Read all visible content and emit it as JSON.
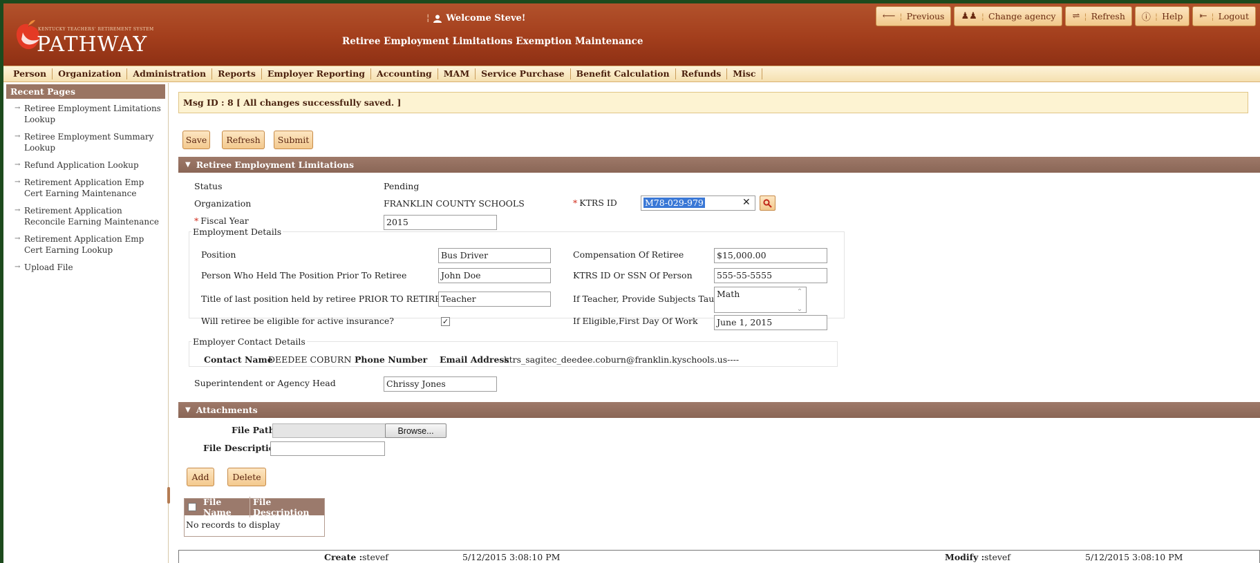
{
  "header": {
    "logo_small": "KENTUCKY TEACHERS' RETIREMENT SYSTEM",
    "logo_big": "PATHWAY",
    "welcome": "Welcome  Steve!",
    "page_title": "Retiree Employment Limitations Exemption Maintenance",
    "buttons": {
      "previous": "Previous",
      "change_agency": "Change agency",
      "refresh": "Refresh",
      "help": "Help",
      "logout": "Logout"
    }
  },
  "menu": [
    "Person",
    "Organization",
    "Administration",
    "Reports",
    "Employer Reporting",
    "Accounting",
    "MAM",
    "Service Purchase",
    "Benefit Calculation",
    "Refunds",
    "Misc"
  ],
  "sidebar": {
    "title": "Recent Pages",
    "items": [
      "Retiree Employment Limitations Lookup",
      "Retiree Employment Summary Lookup",
      "Refund Application Lookup",
      "Retirement Application Emp Cert Earning Maintenance",
      "Retirement Application Reconcile Earning Maintenance",
      "Retirement Application Emp Cert Earning Lookup",
      "Upload File"
    ]
  },
  "message": "Msg ID : 8 [ All changes successfully saved. ]",
  "actions": {
    "save": "Save",
    "refresh": "Refresh",
    "submit": "Submit"
  },
  "limitations": {
    "section_title": "Retiree Employment Limitations",
    "status_label": "Status",
    "status_value": "Pending",
    "organization_label": "Organization",
    "organization_value": "FRANKLIN COUNTY SCHOOLS",
    "ktrs_id_label": "KTRS ID",
    "ktrs_id_value": "M78-029-979",
    "fiscal_year_label": "Fiscal Year",
    "fiscal_year_value": "2015",
    "employment_details": {
      "legend": "Employment Details",
      "position_label": "Position",
      "position_value": "Bus Driver",
      "prior_holder_label": "Person Who Held The Position Prior To Retiree",
      "prior_holder_value": "John Doe",
      "last_title_label": "Title of last position held by retiree PRIOR TO RETIREMENT",
      "last_title_value": "Teacher",
      "insurance_label": "Will retiree be eligible for active insurance?",
      "insurance_checked": "✓",
      "compensation_label": "Compensation Of Retiree",
      "compensation_value": "$15,000.00",
      "ssn_label": "KTRS ID Or SSN Of Person",
      "ssn_value": "555-55-5555",
      "subjects_label": "If Teacher, Provide Subjects Taught",
      "subjects_value": "Math",
      "first_day_label": "If Eligible,First Day Of Work",
      "first_day_value": "June 1, 2015"
    },
    "employer_contact": {
      "legend": "Employer Contact Details",
      "contact_name_label": "Contact Name",
      "contact_name_value": "DEEDEE COBURN",
      "phone_label": "Phone Number",
      "phone_value": "",
      "email_label": "Email Address",
      "email_value": "ktrs_sagitec_deedee.coburn@franklin.kyschools.us----"
    },
    "superintendent_label": "Superintendent or Agency Head",
    "superintendent_value": "Chrissy Jones"
  },
  "attachments": {
    "section_title": "Attachments",
    "file_path_label": "File Path",
    "browse_label": "Browse...",
    "file_description_label": "File Description",
    "add_label": "Add",
    "delete_label": "Delete",
    "columns": [
      "File Name",
      "File Description"
    ],
    "empty_text": "No records to display"
  },
  "footer": {
    "create_label": "Create :",
    "create_user": "stevef",
    "create_date": "5/12/2015 3:08:10 PM",
    "modify_label": "Modify :",
    "modify_user": "stevef",
    "modify_date": "5/12/2015 3:08:10 PM"
  },
  "colors": {
    "header": "#a33e1c",
    "section_bar": "#8a6656",
    "button_bg": "#f3c98e",
    "message_bg": "#fdf3d2"
  }
}
